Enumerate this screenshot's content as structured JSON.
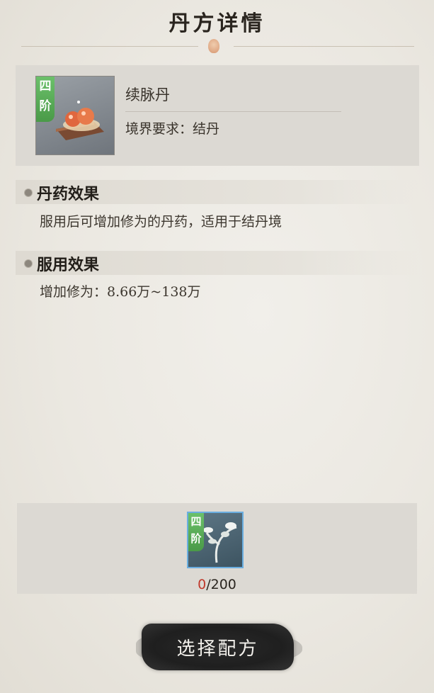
{
  "header": {
    "title": "丹方详情"
  },
  "item": {
    "tier_badge": "四阶",
    "name": "续脉丹",
    "requirement": "境界要求：结丹"
  },
  "sections": [
    {
      "heading": "丹药效果",
      "text": "服用后可增加修为的丹药，适用于结丹境"
    },
    {
      "heading": "服用效果",
      "text": "增加修为：8.66万~138万"
    }
  ],
  "material": {
    "tier_badge": "四阶",
    "icon": "herb-icon",
    "have": "0",
    "need": "/200"
  },
  "actions": {
    "select_recipe_label": "选择配方"
  },
  "colors": {
    "tier_green": "#5aae58",
    "count_short": "#c0392b",
    "material_border": "#6aaee0"
  }
}
